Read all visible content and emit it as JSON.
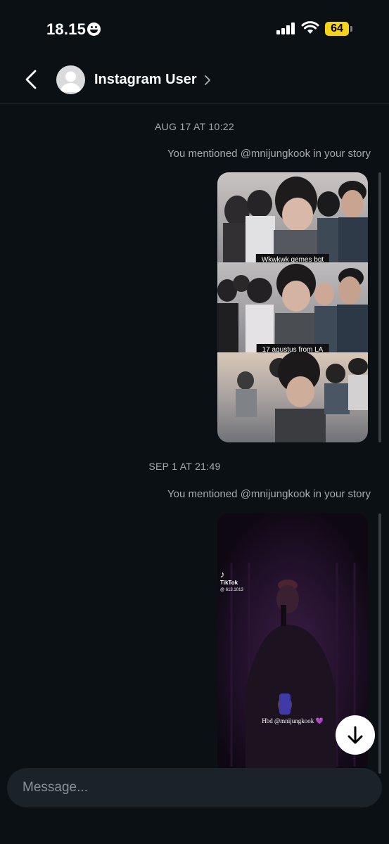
{
  "status_bar": {
    "time": "18.15",
    "battery": "64",
    "icons": [
      "smiley-emoji-icon",
      "cellular-signal-icon",
      "wifi-icon",
      "battery-icon"
    ]
  },
  "header": {
    "back_icon": "chevron-left-icon",
    "title": "Instagram User",
    "title_chevron_icon": "chevron-right-icon"
  },
  "thread": [
    {
      "timestamp": "AUG 17 AT 10:22",
      "mention": "You mentioned @mnijungkook in your story",
      "story": {
        "captions": [
          "Wkwkwk gemes bgt",
          "17 agustus from LA"
        ]
      }
    },
    {
      "timestamp": "SEP 1 AT 21:49",
      "mention": "You mentioned @mnijungkook in your story",
      "story": {
        "tiktok_brand": "TikTok",
        "tiktok_handle": "@ 613.1013",
        "caption": "Hbd @mnijungkook 💜"
      }
    }
  ],
  "scroll_down_icon": "arrow-down-icon",
  "composer": {
    "placeholder": "Message..."
  },
  "colors": {
    "background": "#0b1014",
    "secondary_text": "#a6abb0",
    "composer_bg": "#1c2328",
    "battery": "#f6d21a"
  }
}
